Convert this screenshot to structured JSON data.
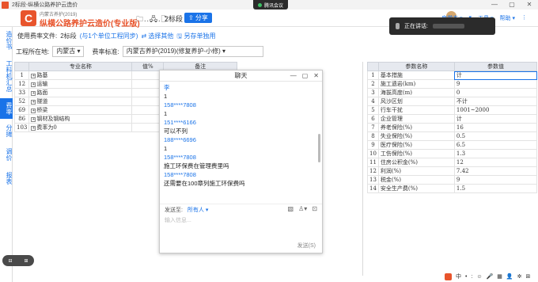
{
  "window": {
    "title": "2标段-纵横公路养护云造价",
    "meeting_label": "腾讯会议",
    "controls": [
      "—",
      "▢",
      "✕"
    ]
  },
  "header": {
    "logo_letter": "C",
    "subtitle": "内蒙古养护(2019)",
    "product_name": "纵横公路养护云造价(专业版)",
    "toolbar_icons": "🗀..🖧.🗋",
    "file_name": "2标段",
    "share_label": "⇪ 分享",
    "right_items": [
      "启学本 ▾",
      "▾",
      "工具 ▾",
      "帮助 ▾",
      "⋮"
    ]
  },
  "toast": {
    "text": "正在讲话:"
  },
  "sidebar": {
    "items": [
      {
        "label": "造价书",
        "active": false
      },
      {
        "label": "工料机汇总",
        "active": false
      },
      {
        "label": "费率",
        "active": true
      },
      {
        "label": "分摊",
        "active": false
      },
      {
        "label": "调价",
        "active": false
      },
      {
        "label": "报表",
        "active": false
      }
    ]
  },
  "rate_bar": {
    "file_label": "使用费率文件:",
    "file_name": "2标段",
    "sync_link": "(与1个单位工程同步)",
    "select_link": "⇄ 选择其他",
    "save_link": "🖫 另存单独用"
  },
  "location_bar": {
    "location_label": "工程所在地:",
    "location_value": "内蒙古 ▾",
    "standard_label": "费率标准:",
    "standard_value": "内蒙古养护(2019)(修复养护-小修) ▾"
  },
  "main_table": {
    "headers": [
      "",
      "专业名称",
      "值%",
      "备注"
    ],
    "rows": [
      {
        "idx": "1",
        "name": "路基",
        "value": ""
      },
      {
        "idx": "12",
        "name": "运输",
        "value": ""
      },
      {
        "idx": "33",
        "name": "路面",
        "value": ""
      },
      {
        "idx": "52",
        "name": "隧道",
        "value": ""
      },
      {
        "idx": "69",
        "name": "桥梁",
        "value": ""
      },
      {
        "idx": "86",
        "name": "钢材及钢结构",
        "value": ""
      },
      {
        "idx": "103",
        "name": "费率为0",
        "value": ""
      }
    ]
  },
  "chat": {
    "title": "聊天",
    "controls": [
      "—",
      "▢",
      "✕"
    ],
    "messages": [
      {
        "name": "李",
        "text": "1"
      },
      {
        "name": "158****7808",
        "text": "1"
      },
      {
        "name": "151****6166",
        "text": "可以不列"
      },
      {
        "name": "188****6696",
        "text": "1"
      },
      {
        "name": "158****7808",
        "text": "施工环保费在管理费里吗"
      },
      {
        "name": "158****7808",
        "text": "还需要在100章列施工环保费吗"
      }
    ],
    "send_to_label": "发送至:",
    "send_to_value": "所有人 ▾",
    "tools": [
      "▧",
      "♙▾",
      "⊡"
    ],
    "input_placeholder": "输入信息...",
    "send_label": "发送(S)"
  },
  "param_table": {
    "headers": [
      "",
      "参数名称",
      "参数值"
    ],
    "rows": [
      {
        "idx": "1",
        "name": "基本措施",
        "value": "计"
      },
      {
        "idx": "2",
        "name": "施工遗岩(km)",
        "value": "9"
      },
      {
        "idx": "3",
        "name": "海拔高度(m)",
        "value": "0"
      },
      {
        "idx": "4",
        "name": "风沙区划",
        "value": "不计"
      },
      {
        "idx": "5",
        "name": "行车干扰",
        "value": "1001~2000"
      },
      {
        "idx": "6",
        "name": "企业管理",
        "value": "计"
      },
      {
        "idx": "7",
        "name": "养老保险(%)",
        "value": "16"
      },
      {
        "idx": "8",
        "name": "失业保险(%)",
        "value": "0.5"
      },
      {
        "idx": "9",
        "name": "医疗保险(%)",
        "value": "6.5"
      },
      {
        "idx": "10",
        "name": "工伤保险(%)",
        "value": "1.3"
      },
      {
        "idx": "11",
        "name": "住房公积金(%)",
        "value": "12"
      },
      {
        "idx": "12",
        "name": "利润(%)",
        "value": "7.42"
      },
      {
        "idx": "13",
        "name": "税金(%)",
        "value": "9"
      },
      {
        "idx": "14",
        "name": "安全生产费(%)",
        "value": "1.5"
      }
    ]
  },
  "zoom_widget": [
    "⊟",
    "⊞"
  ],
  "taskbar": [
    "中",
    "•",
    ":",
    "☺",
    "🎤",
    "▦",
    "👤",
    "✲",
    "⊞"
  ]
}
